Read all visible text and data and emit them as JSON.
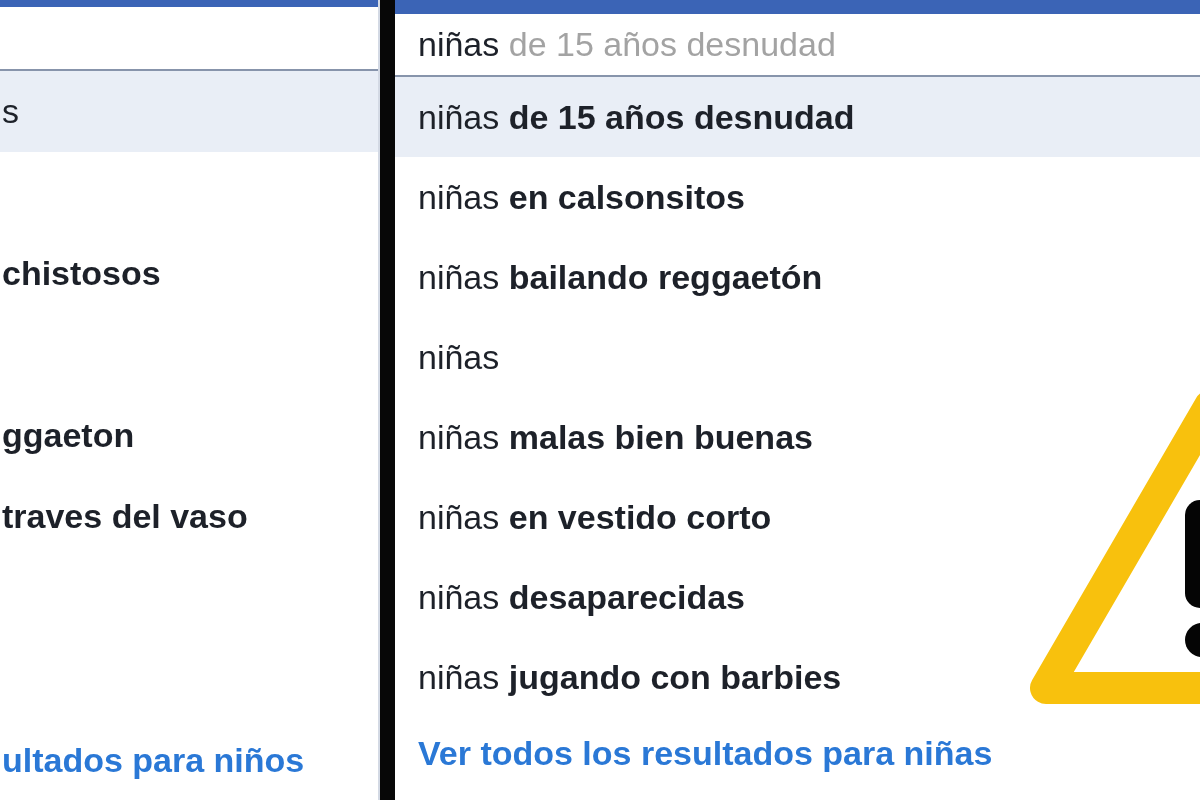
{
  "panels": [
    {
      "suggestions": [
        {
          "typed": "s",
          "selected": true
        },
        {
          "selected": false
        },
        {
          "completion": "chistosos",
          "selected": false
        },
        {
          "selected": false
        },
        {
          "completion": "ggaeton",
          "selected": false
        },
        {
          "completion": "traves del vaso",
          "selected": false
        },
        {
          "selected": false
        },
        {
          "selected": false
        }
      ],
      "see_all_link": "ultados para niños"
    },
    {
      "search": {
        "value": "niñas",
        "hint": "de 15 años desnudad"
      },
      "suggestions": [
        {
          "typed": "niñas",
          "completion": "de 15 años desnudad",
          "selected": true
        },
        {
          "typed": "niñas",
          "completion": "en calsonsitos",
          "selected": false
        },
        {
          "typed": "niñas",
          "completion": "bailando reggaetón",
          "selected": false
        },
        {
          "typed": "niñas",
          "selected": false
        },
        {
          "typed": "niñas",
          "completion": "malas bien buenas",
          "selected": false
        },
        {
          "typed": "niñas",
          "completion": "en vestido corto",
          "selected": false
        },
        {
          "typed": "niñas",
          "completion": "desaparecidas",
          "selected": false
        },
        {
          "typed": "niñas",
          "completion": "jugando con barbies",
          "selected": false
        }
      ],
      "see_all_link": "Ver todos los resultados para niñas"
    }
  ]
}
